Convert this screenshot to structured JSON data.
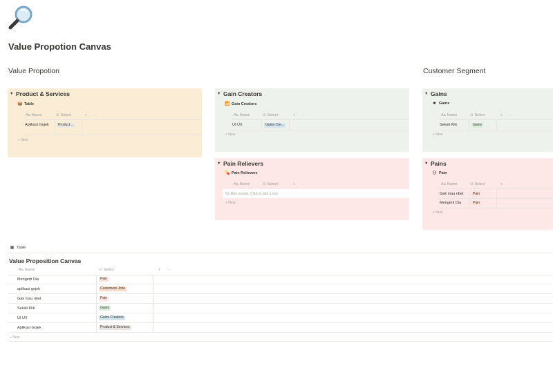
{
  "page": {
    "icon": "magnifying-glass-icon",
    "title": "Value Propotion Canvas"
  },
  "sections": {
    "left_heading": "Value Propotion",
    "right_heading": "Customer Segment"
  },
  "columns": {
    "name": "Name",
    "name_prefix": "Aa",
    "select": "Select",
    "add": "+",
    "more": "···"
  },
  "new_label": "+ New",
  "callouts": {
    "product_services": {
      "title": "Product & Services",
      "view_icon": "box-icon",
      "view_name": "Table",
      "rows": [
        {
          "name": "Aplikasi Gojek",
          "tag": "Product ..."
        }
      ]
    },
    "gain_creators": {
      "title": "Gain Creators",
      "view_icon": "chart-icon",
      "view_name": "Gain Creators",
      "rows": [
        {
          "name": "UI UX",
          "tag": "Gains Cre..."
        }
      ]
    },
    "pain_relievers": {
      "title": "Pain Relievers",
      "view_icon": "pill-icon",
      "view_name": "Pain Relievers",
      "empty_text": "No filter results. Click to add a row."
    },
    "gains": {
      "title": "Gains",
      "view_icon": "smile-icon",
      "view_name": "Gains",
      "rows": [
        {
          "name": "Sekali Klik",
          "tag": "Gains"
        }
      ]
    },
    "pains": {
      "title": "Pains",
      "view_icon": "frown-icon",
      "view_name": "Pain",
      "rows": [
        {
          "name": "Gak mau ribet",
          "tag": "Pain"
        },
        {
          "name": "Mengerti Dia",
          "tag": "Pain"
        }
      ]
    }
  },
  "bottom_table": {
    "view_icon": "table-icon",
    "view_name": "Table",
    "title": "Value Proposition Canvas",
    "rows": [
      {
        "name": "Mengerti Dia",
        "tag": "Pain"
      },
      {
        "name": "aplikasi gojek",
        "tag": "Customers Jobs"
      },
      {
        "name": "Gak mau ribet",
        "tag": "Pain"
      },
      {
        "name": "Sekali Klik",
        "tag": "Gains"
      },
      {
        "name": "UI UX",
        "tag": "Gains Creators"
      },
      {
        "name": "Aplikasi Gojek",
        "tag": "Product & Services"
      }
    ]
  }
}
